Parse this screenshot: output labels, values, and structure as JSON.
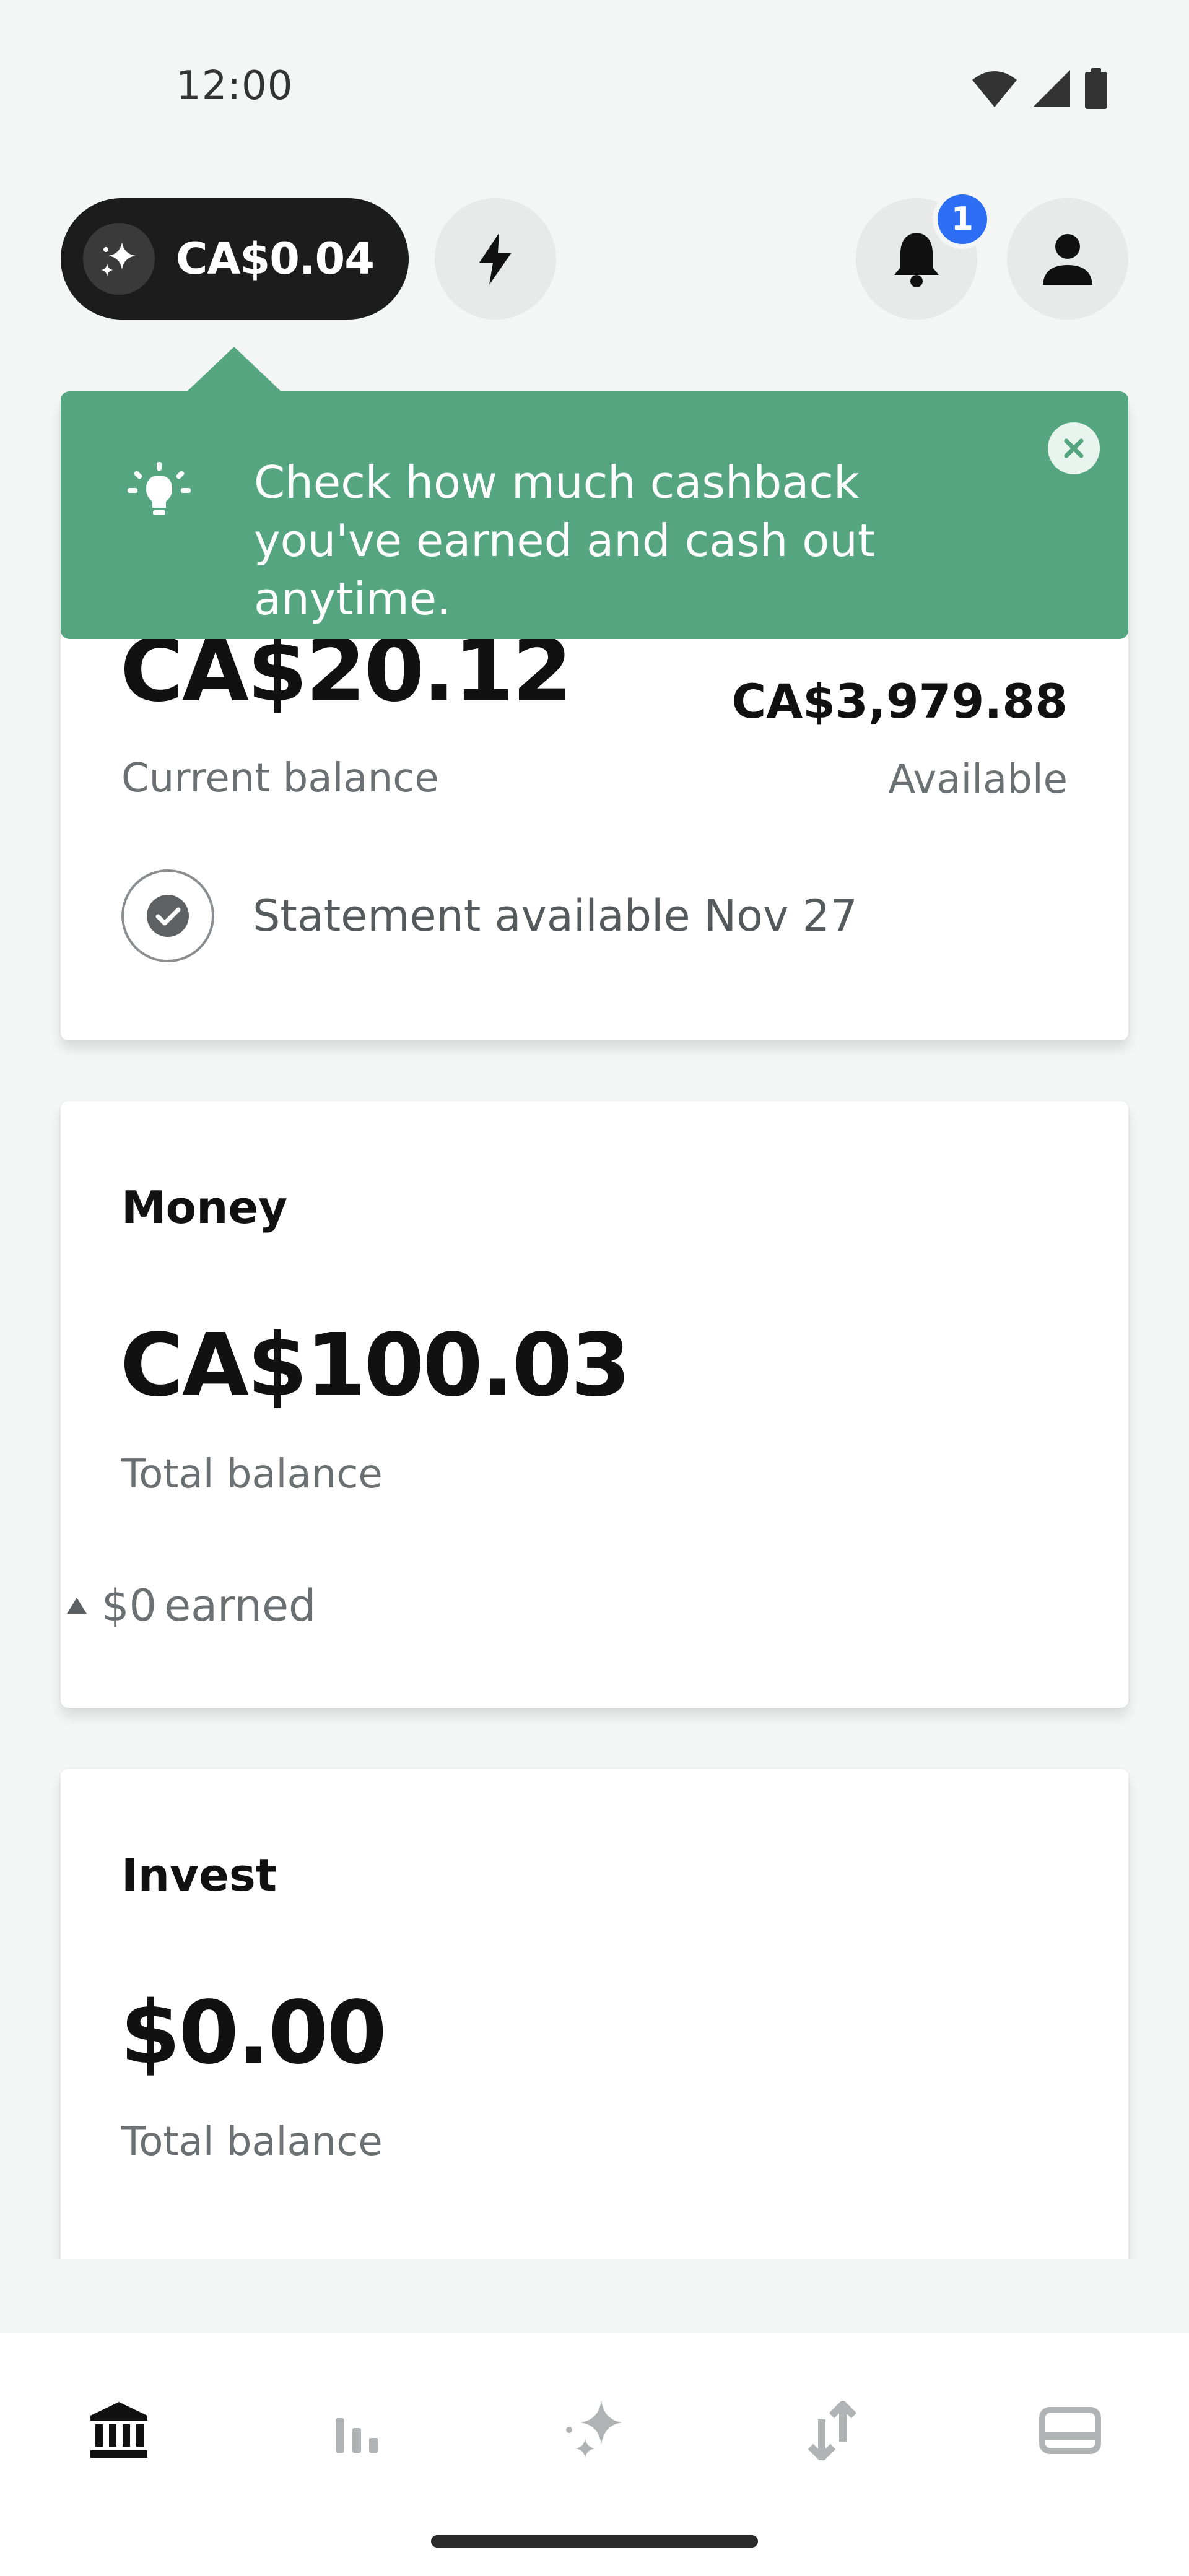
{
  "status_bar": {
    "time": "12:00"
  },
  "header": {
    "cashback_amount": "CA$0.04",
    "notification_count": "1"
  },
  "tooltip": {
    "text": "Check how much cashback you've earned and cash out anytime."
  },
  "credit_card": {
    "current_balance": "CA$20.12",
    "current_balance_label": "Current balance",
    "available_amount": "CA$3,979.88",
    "available_label": "Available",
    "statement_text": "Statement available Nov 27"
  },
  "money_card": {
    "title": "Money",
    "total_balance": "CA$100.03",
    "total_balance_label": "Total balance",
    "earned_amount": "$0",
    "earned_label": "earned"
  },
  "invest_card": {
    "title": "Invest",
    "total_balance": "$0.00",
    "total_balance_label": "Total balance"
  },
  "bottom_nav": {
    "items": [
      "bank-icon",
      "chart-icon",
      "sparkles-icon",
      "transfer-icon",
      "card-icon"
    ],
    "active_index": 0
  },
  "colors": {
    "accent_green": "#55a680",
    "badge_blue": "#2d6ef5",
    "pill_dark": "#1c1c1c"
  }
}
